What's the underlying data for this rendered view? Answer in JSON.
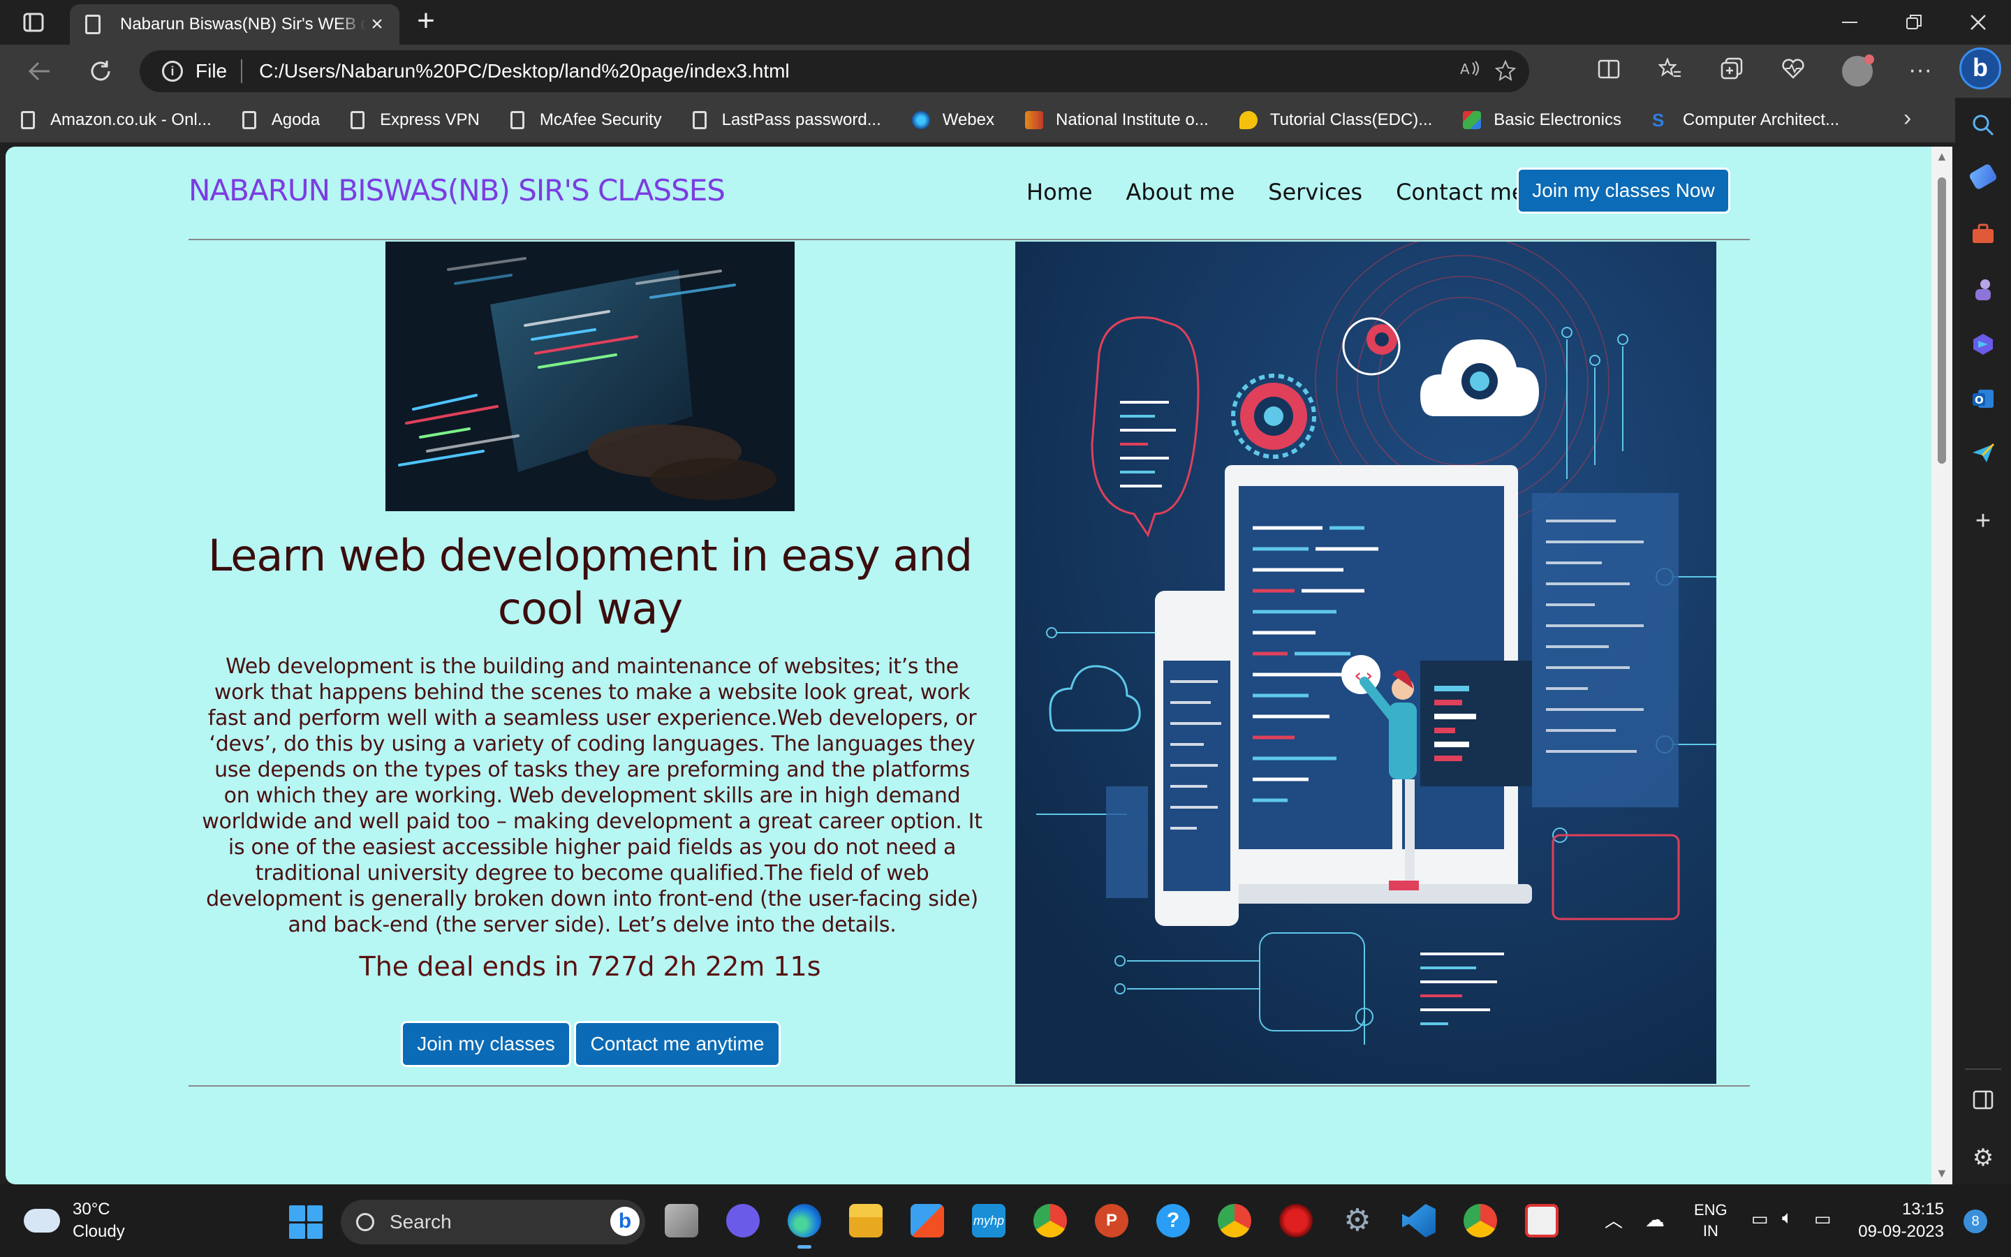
{
  "browser": {
    "tab_title": "Nabarun Biswas(NB) Sir's WEB de",
    "address_scheme": "File",
    "address_url": "C:/Users/Nabarun%20PC/Desktop/land%20page/index3.html",
    "favorites": [
      {
        "label": "Amazon.co.uk - Onl...",
        "icon": "page-icon"
      },
      {
        "label": "Agoda",
        "icon": "page-icon"
      },
      {
        "label": "Express VPN",
        "icon": "page-icon"
      },
      {
        "label": "McAfee Security",
        "icon": "page-icon"
      },
      {
        "label": "LastPass password...",
        "icon": "page-icon"
      },
      {
        "label": "Webex",
        "icon": "webex-icon",
        "color": "#3ec4ff"
      },
      {
        "label": "National Institute o...",
        "icon": "nit-icon",
        "color": "#e38a1a"
      },
      {
        "label": "Tutorial Class(EDC)...",
        "icon": "tutorial-icon",
        "color": "#f4c20d"
      },
      {
        "label": "Basic Electronics",
        "icon": "electronics-icon",
        "color": "#3cae4a"
      },
      {
        "label": "Computer Architect...",
        "icon": "architecture-icon",
        "color": "#2f7de1"
      }
    ]
  },
  "page": {
    "brand": "NABARUN BISWAS(NB) SIR'S CLASSES",
    "nav": [
      "Home",
      "About me",
      "Services",
      "Contact me"
    ],
    "cta_top": "Join my classes Now",
    "headline": "Learn web development in easy and cool way",
    "paragraph": "Web development is the building and maintenance of websites; it’s the work that happens behind the scenes to make a website look great, work fast and perform well with a seamless user experience.Web developers, or ‘devs’, do this by using a variety of coding languages. The languages they use depends on the types of tasks they are preforming and the platforms on which they are working. Web development skills are in high demand worldwide and well paid too – making development a great career option. It is one of the easiest accessible higher paid fields as you do not need a traditional university degree to become qualified.The field of web development is generally broken down into front-end (the user-facing side) and back-end (the server side). Let’s delve into the details.",
    "countdown": "The deal ends in 727d 2h 22m 11s",
    "btn_join": "Join my classes",
    "btn_contact": "Contact me anytime",
    "colors": {
      "background": "#b6f6f3",
      "brand": "#7b3de0",
      "button": "#0b6bb6",
      "text": "#4a1010"
    }
  },
  "taskbar": {
    "weather_temp": "30°C",
    "weather_desc": "Cloudy",
    "search_label": "Search",
    "lang_top": "ENG",
    "lang_bottom": "IN",
    "time": "13:15",
    "date": "09-09-2023",
    "notifications": "8"
  }
}
